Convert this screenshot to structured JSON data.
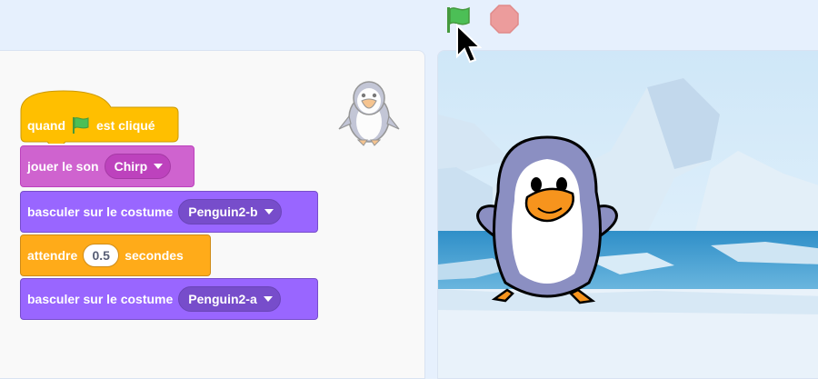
{
  "controls": {
    "green_flag_icon": "green-flag-icon",
    "stop_icon": "stop-sign-icon"
  },
  "scripts": {
    "hat": {
      "prefix": "quand",
      "suffix": "est cliqué"
    },
    "play_sound": {
      "label": "jouer le son",
      "sound": "Chirp"
    },
    "switch_costume_1": {
      "label": "basculer sur le costume",
      "costume": "Penguin2-b"
    },
    "wait": {
      "prefix": "attendre",
      "value": "0.5",
      "suffix": "secondes"
    },
    "switch_costume_2": {
      "label": "basculer sur le costume",
      "costume": "Penguin2-a"
    }
  },
  "colors": {
    "events": "#ffbf00",
    "sound": "#cf63cf",
    "looks": "#9966ff",
    "control": "#ffab19",
    "flag_green": "#4cbf56",
    "stop_red": "#ec9c9c"
  }
}
